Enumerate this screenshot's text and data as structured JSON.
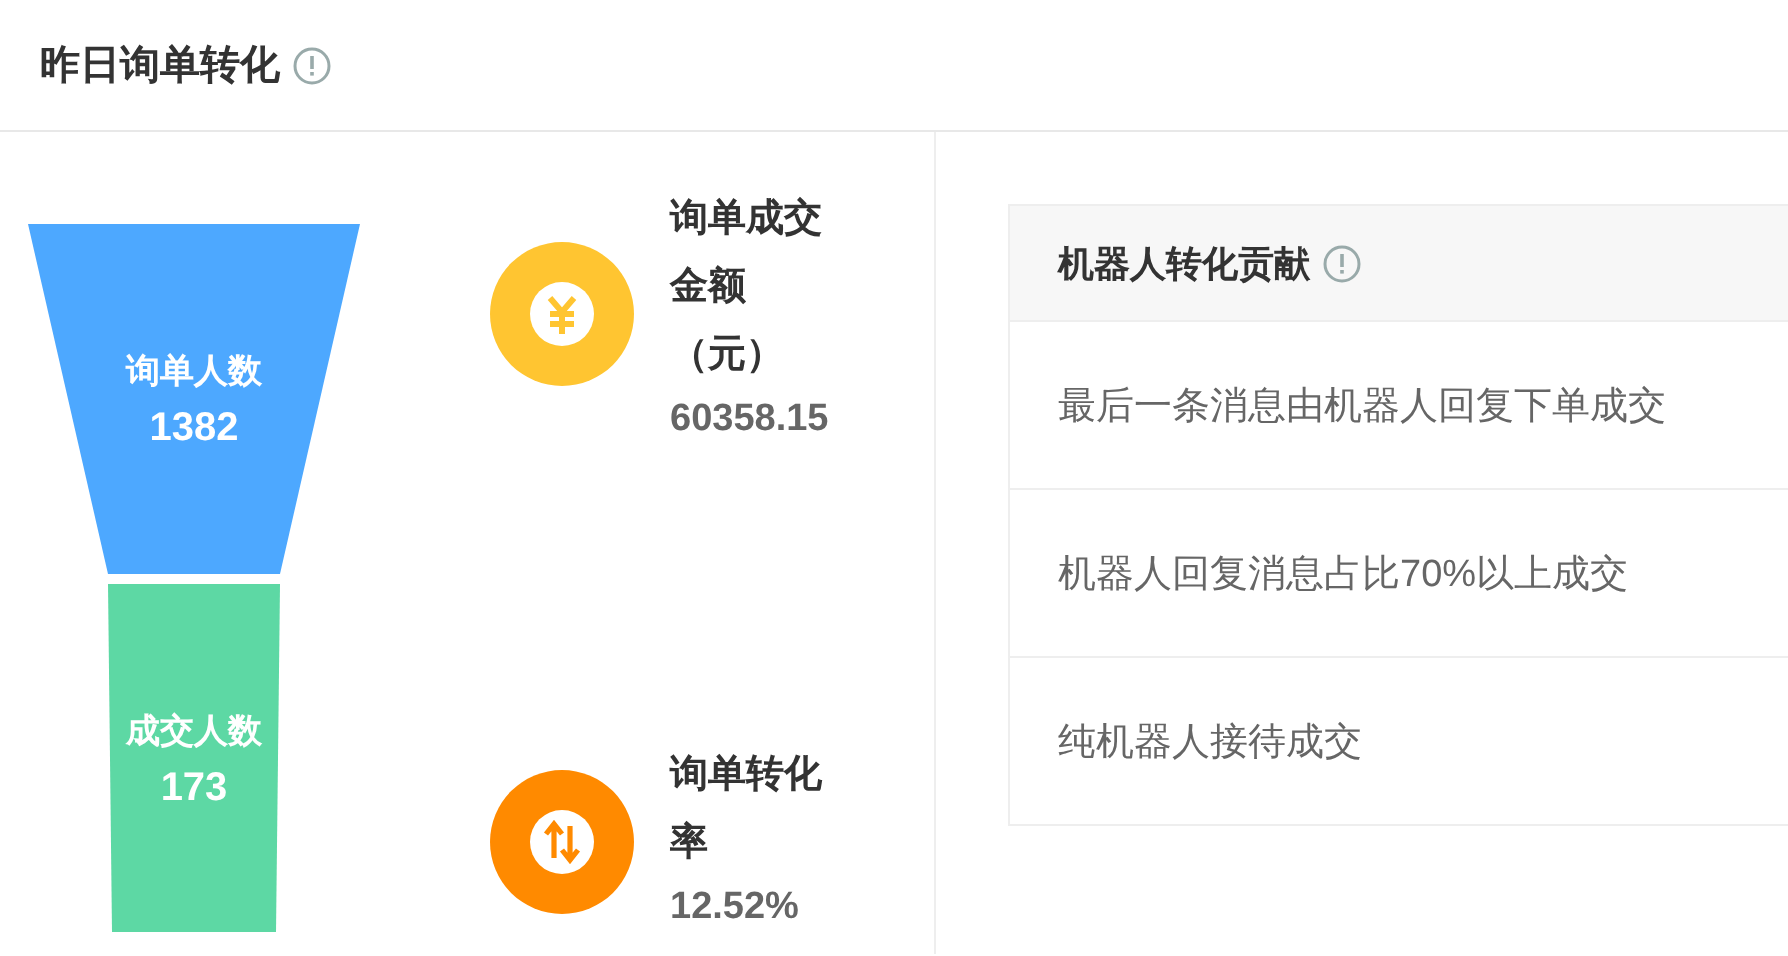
{
  "title": "昨日询单转化",
  "funnel": [
    {
      "label": "询单人数",
      "value": "1382",
      "color": "#4da8ff"
    },
    {
      "label": "成交人数",
      "value": "173",
      "color": "#5dd8a4"
    }
  ],
  "stats": [
    {
      "kind": "amount",
      "label": "询单成交金额（元）",
      "value": "60358.15"
    },
    {
      "kind": "rate",
      "label": "询单转化率",
      "value": "12.52%"
    }
  ],
  "table": {
    "header": "机器人转化贡献",
    "rows": [
      "最后一条消息由机器人回复下单成交",
      "机器人回复消息占比70%以上成交",
      "纯机器人接待成交"
    ]
  }
}
